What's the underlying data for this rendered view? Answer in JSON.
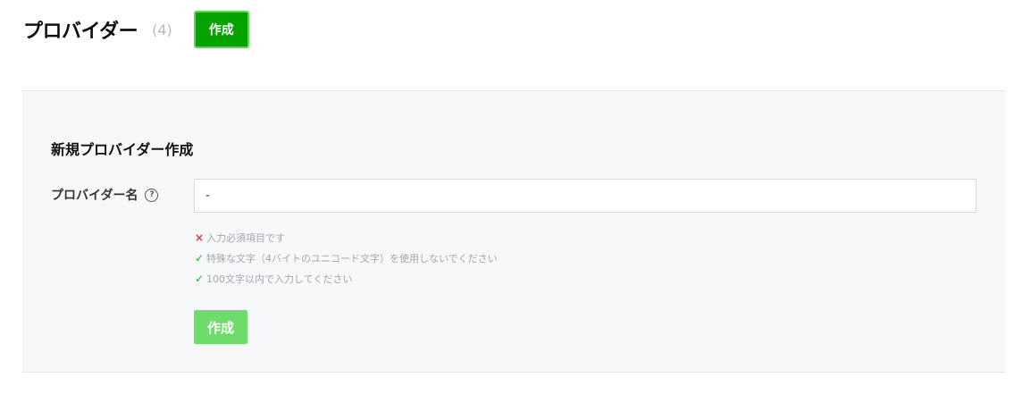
{
  "header": {
    "title": "プロバイダー",
    "count": "(4)",
    "create_button": "作成"
  },
  "form": {
    "title": "新規プロバイダー作成",
    "field_label": "プロバイダー名",
    "help_icon": "?",
    "input_value": "-",
    "rules": [
      {
        "status": "error",
        "icon": "×",
        "text": "入力必須項目です"
      },
      {
        "status": "ok",
        "icon": "✓",
        "text": "特殊な文字（4バイトのユニコード文字）を使用しないでください"
      },
      {
        "status": "ok",
        "icon": "✓",
        "text": "100文字以内で入力してください"
      }
    ],
    "submit_button": "作成",
    "submit_disabled": true
  },
  "colors": {
    "primary_green": "#06a300",
    "disabled_green": "#6ddc6a",
    "error_red": "#e5333d",
    "ok_green": "#2ca83a",
    "panel_bg": "#f7f8f9"
  }
}
